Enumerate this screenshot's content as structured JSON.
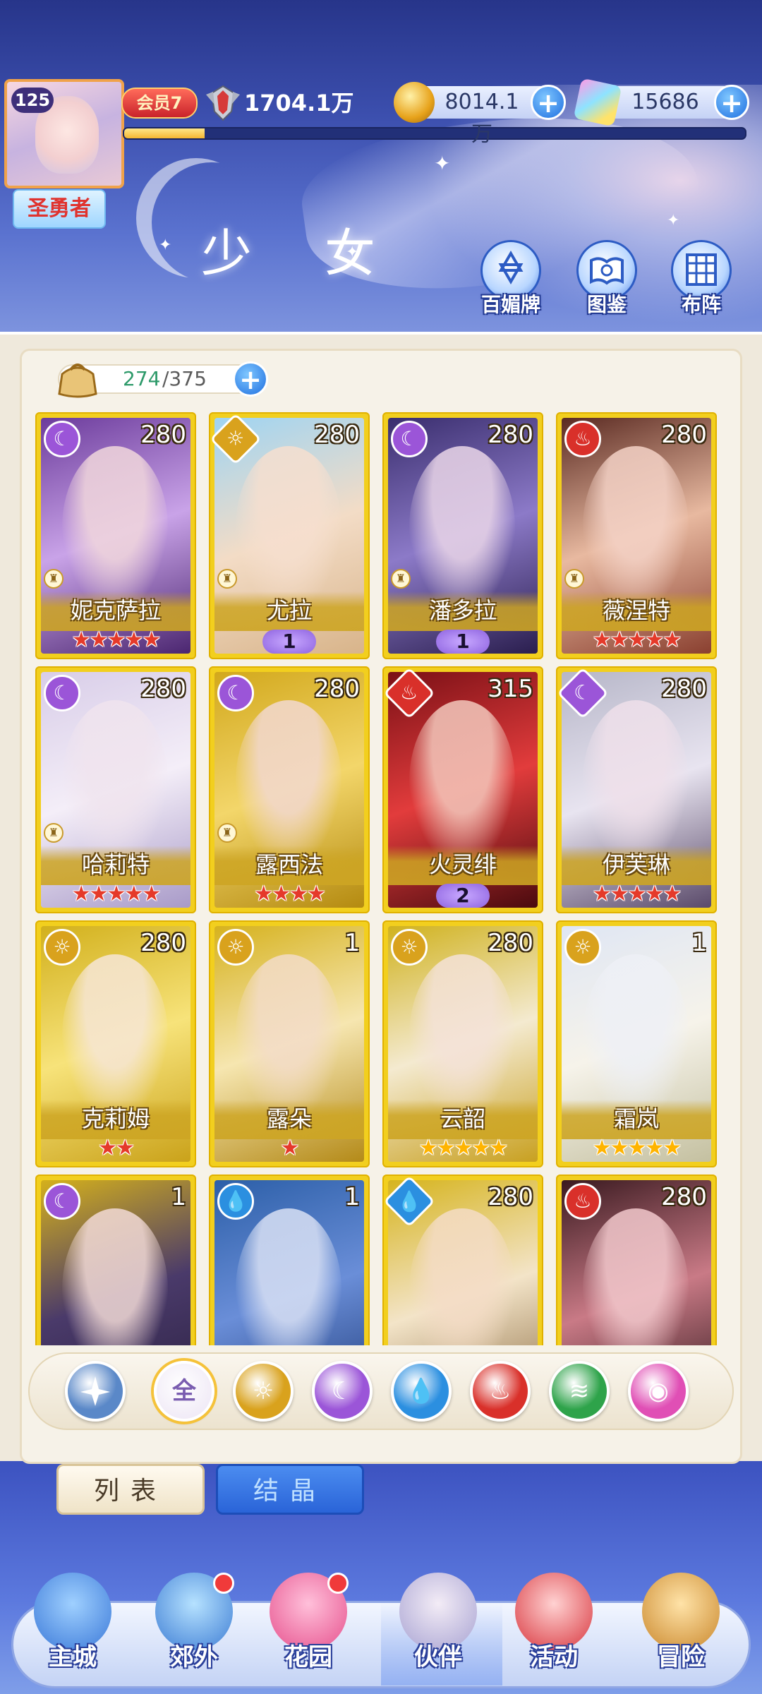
{
  "header": {
    "player_level": "125",
    "title_badge": "圣勇者",
    "vip_label": "会员7",
    "power": "1704.1万",
    "exp_progress": 0.13,
    "gold": "8014.1万",
    "gems": "15686",
    "plus_symbol": "+",
    "page_title": "少 女",
    "buttons": [
      "百媚牌",
      "图鉴",
      "布阵"
    ]
  },
  "roster": {
    "count_current": "274",
    "count_max": "/375"
  },
  "cards": [
    {
      "name": "妮克萨拉",
      "level": "280",
      "element": "moon",
      "stars": 5,
      "star_color": "red",
      "badge": "",
      "role": true
    },
    {
      "name": "尤拉",
      "level": "280",
      "element": "sun",
      "stars": 0,
      "star_color": "",
      "badge": "1",
      "role": true
    },
    {
      "name": "潘多拉",
      "level": "280",
      "element": "moon",
      "stars": 0,
      "star_color": "",
      "badge": "1",
      "role": true
    },
    {
      "name": "薇涅特",
      "level": "280",
      "element": "fire",
      "stars": 5,
      "star_color": "red",
      "badge": "",
      "role": true
    },
    {
      "name": "哈莉特",
      "level": "280",
      "element": "moon",
      "stars": 5,
      "star_color": "red",
      "badge": "",
      "role": true
    },
    {
      "name": "露西法",
      "level": "280",
      "element": "moon",
      "stars": 4,
      "star_color": "red",
      "badge": "",
      "role": true
    },
    {
      "name": "火灵绯",
      "level": "315",
      "element": "fire",
      "stars": 0,
      "star_color": "",
      "badge": "2",
      "role": false
    },
    {
      "name": "伊芙琳",
      "level": "280",
      "element": "moon",
      "stars": 5,
      "star_color": "red",
      "badge": "",
      "role": false
    },
    {
      "name": "克莉姆",
      "level": "280",
      "element": "sun",
      "stars": 2,
      "star_color": "red",
      "badge": "",
      "role": false
    },
    {
      "name": "露朵",
      "level": "1",
      "element": "sun",
      "stars": 1,
      "star_color": "red",
      "badge": "",
      "role": false
    },
    {
      "name": "云韶",
      "level": "280",
      "element": "sun",
      "stars": 5,
      "star_color": "gold",
      "badge": "",
      "role": false
    },
    {
      "name": "霜岚",
      "level": "1",
      "element": "sun",
      "stars": 5,
      "star_color": "gold",
      "badge": "",
      "role": false
    },
    {
      "name": "",
      "level": "1",
      "element": "moon",
      "stars": 0,
      "star_color": "",
      "badge": "",
      "role": false
    },
    {
      "name": "",
      "level": "1",
      "element": "water",
      "stars": 0,
      "star_color": "",
      "badge": "",
      "role": false
    },
    {
      "name": "",
      "level": "280",
      "element": "water",
      "stars": 0,
      "star_color": "",
      "badge": "",
      "role": false
    },
    {
      "name": "",
      "level": "280",
      "element": "fire",
      "stars": 0,
      "star_color": "",
      "badge": "",
      "role": false
    }
  ],
  "filters": [
    {
      "id": "special",
      "label": "",
      "color": "#5a88c8"
    },
    {
      "id": "all",
      "label": "全",
      "color": "#f6f1e4"
    },
    {
      "id": "sun",
      "label": "☼",
      "color": "#d9a21d"
    },
    {
      "id": "moon",
      "label": "☾",
      "color": "#9b55d8"
    },
    {
      "id": "water",
      "label": "💧",
      "color": "#2b8fe0"
    },
    {
      "id": "fire",
      "label": "♨",
      "color": "#d9302a"
    },
    {
      "id": "wind",
      "label": "≋",
      "color": "#2ea34a"
    },
    {
      "id": "light",
      "label": "◉",
      "color": "#e04fb5"
    }
  ],
  "tabs": {
    "list": "列表",
    "crystal": "结晶"
  },
  "nav": [
    {
      "label": "主城",
      "dot": false,
      "active": false
    },
    {
      "label": "郊外",
      "dot": true,
      "active": false
    },
    {
      "label": "花园",
      "dot": true,
      "active": false
    },
    {
      "label": "伙伴",
      "dot": false,
      "active": true
    },
    {
      "label": "活动",
      "dot": false,
      "active": false
    },
    {
      "label": "冒险",
      "dot": false,
      "active": false
    }
  ],
  "element_colors": {
    "moon": "#9b55d8",
    "sun": "#d9a21d",
    "fire": "#d9302a",
    "water": "#2b8fe0"
  },
  "element_icons": {
    "moon": "☾",
    "sun": "☼",
    "fire": "♨",
    "water": "💧"
  }
}
